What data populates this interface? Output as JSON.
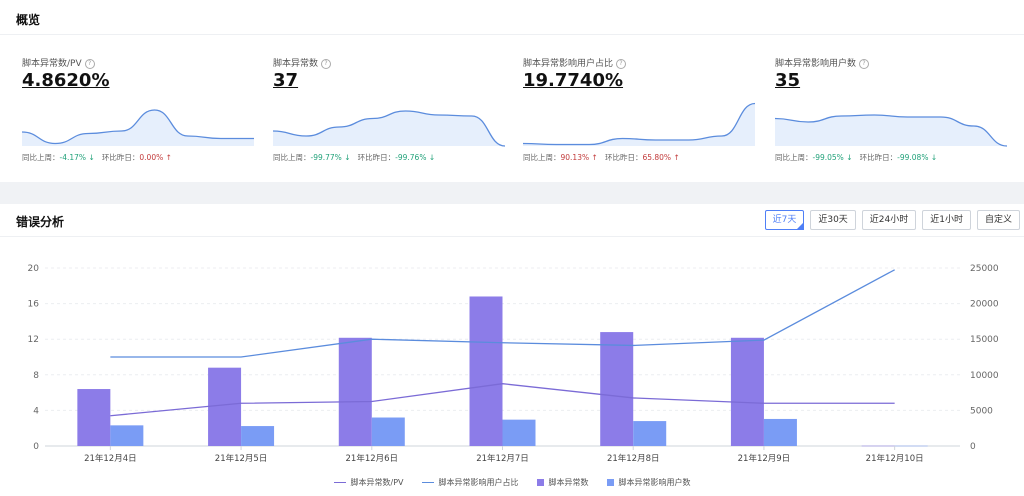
{
  "overview": {
    "title": "概览",
    "kpis": [
      {
        "label": "脚本异常数/PV",
        "value": "4.8620%",
        "wow_label": "同比上周：",
        "wow": "-4.17%",
        "wow_arrow": "↓",
        "dod_label": "环比昨日：",
        "dod": "0.00%",
        "dod_arrow": "↑",
        "trend": [
          0.28,
          0.05,
          0.25,
          0.3,
          0.72,
          0.2,
          0.15,
          0.15
        ]
      },
      {
        "label": "脚本异常数",
        "value": "37",
        "wow_label": "同比上周：",
        "wow": "-99.77%",
        "wow_arrow": "↓",
        "dod_label": "环比昨日：",
        "dod": "-99.76%",
        "dod_arrow": "↓",
        "trend": [
          0.3,
          0.2,
          0.38,
          0.55,
          0.7,
          0.62,
          0.6,
          0.0
        ]
      },
      {
        "label": "脚本异常影响用户占比",
        "value": "19.7740%",
        "wow_label": "同比上周：",
        "wow": "90.13%",
        "wow_arrow": "↑",
        "dod_label": "环比昨日：",
        "dod": "65.80%",
        "dod_arrow": "↑",
        "trend": [
          0.05,
          0.03,
          0.03,
          0.15,
          0.12,
          0.12,
          0.2,
          0.85
        ]
      },
      {
        "label": "脚本异常影响用户数",
        "value": "35",
        "wow_label": "同比上周：",
        "wow": "-99.05%",
        "wow_arrow": "↓",
        "dod_label": "环比昨日：",
        "dod": "-99.08%",
        "dod_arrow": "↓",
        "trend": [
          0.55,
          0.48,
          0.6,
          0.62,
          0.58,
          0.58,
          0.4,
          0.0
        ]
      }
    ]
  },
  "analysis": {
    "title": "错误分析",
    "range_buttons": [
      "近7天",
      "近30天",
      "近24小时",
      "近1小时",
      "自定义"
    ],
    "active_range": "近7天"
  },
  "chart_data": {
    "type": "bar",
    "categories": [
      "21年12月4日",
      "21年12月5日",
      "21年12月6日",
      "21年12月7日",
      "21年12月8日",
      "21年12月9日",
      "21年12月10日"
    ],
    "left_axis": {
      "ticks": [
        0,
        4,
        8,
        12,
        16,
        20
      ],
      "ylim": [
        0,
        20
      ]
    },
    "right_axis": {
      "ticks": [
        0,
        5000,
        10000,
        15000,
        20000,
        25000
      ],
      "ylim": [
        0,
        25000
      ]
    },
    "series": [
      {
        "name": "脚本异常数/PV",
        "kind": "line",
        "axis": "left",
        "color": "#7b6bd6",
        "values": [
          3.4,
          4.8,
          5.0,
          7.0,
          5.4,
          4.8,
          4.8
        ]
      },
      {
        "name": "脚本异常影响用户占比",
        "kind": "line",
        "axis": "left",
        "color": "#5b8cdd",
        "values": [
          10.0,
          10.0,
          12.0,
          11.6,
          11.3,
          11.9,
          19.8
        ]
      },
      {
        "name": "脚本异常数",
        "kind": "bar",
        "axis": "right",
        "color": "#8c7ce8",
        "values": [
          8000,
          11000,
          15200,
          21000,
          16000,
          15200,
          37
        ]
      },
      {
        "name": "脚本异常影响用户数",
        "kind": "bar",
        "axis": "right",
        "color": "#7a9cf5",
        "values": [
          2900,
          2800,
          4000,
          3700,
          3500,
          3800,
          35
        ]
      }
    ],
    "legend_position": "bottom",
    "grid": true
  }
}
